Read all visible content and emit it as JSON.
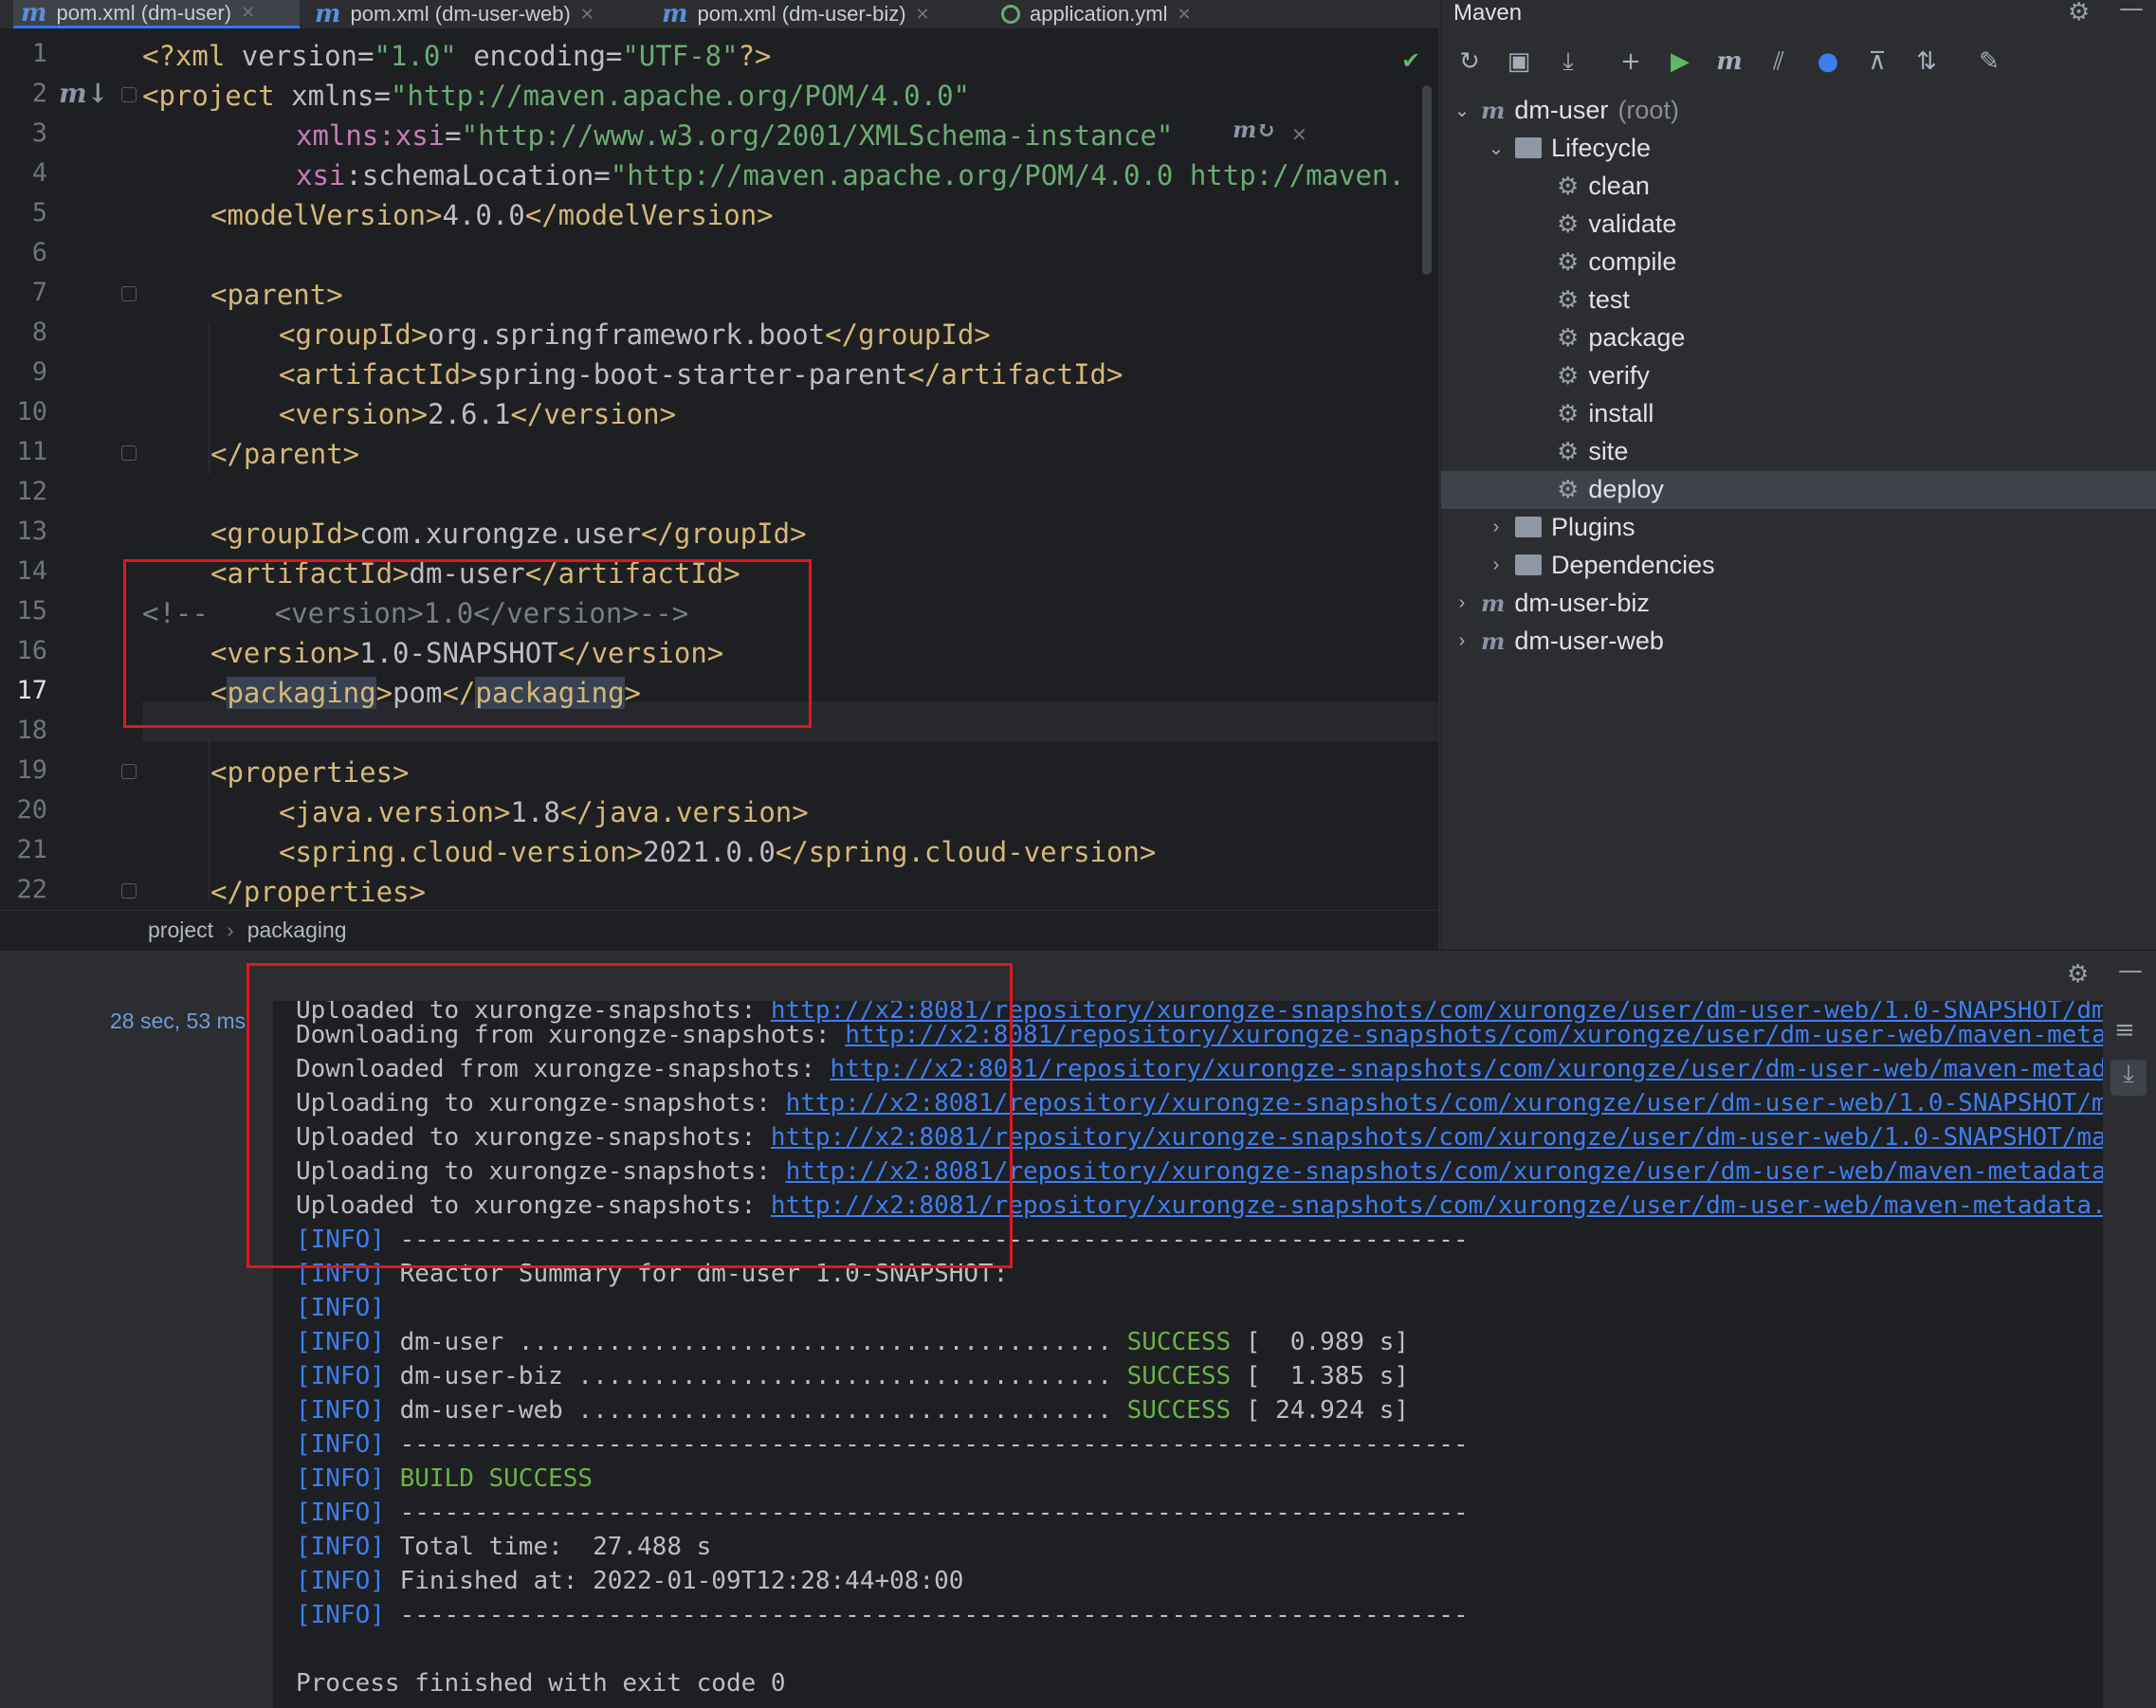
{
  "tabs": [
    {
      "label": "pom.xml (dm-user)",
      "active": true,
      "icon": "maven-icon"
    },
    {
      "label": "pom.xml (dm-user-web)",
      "active": false,
      "icon": "maven-icon"
    },
    {
      "label": "pom.xml (dm-user-biz)",
      "active": false,
      "icon": "maven-icon"
    },
    {
      "label": "application.yml",
      "active": false,
      "icon": "yaml-icon"
    }
  ],
  "editor": {
    "line_numbers": [
      "1",
      "2",
      "3",
      "4",
      "5",
      "6",
      "7",
      "8",
      "9",
      "10",
      "11",
      "12",
      "13",
      "14",
      "15",
      "16",
      "17",
      "18",
      "19",
      "20",
      "21",
      "22"
    ],
    "current_line": "17",
    "lines": {
      "l1": [
        "<?",
        "xml ",
        "version",
        "=",
        "\"1.0\"",
        " encoding",
        "=",
        "\"UTF-8\"",
        "?>"
      ],
      "l2_tag": "<project",
      "l2_attr": " xmlns",
      "l2_eq": "=",
      "l2_val": "\"http://maven.apache.org/POM/4.0.0\"",
      "l3_ns": "xmlns:xsi",
      "l3_eq": "=",
      "l3_val": "\"http://www.w3.org/2001/XMLSchema-instance\"",
      "l4_ns": "xsi",
      "l4_attr": ":schemaLocation",
      "l4_eq": "=",
      "l4_val": "\"http://maven.apache.org/POM/4.0.0 http://maven.",
      "l5": [
        "<modelVersion>",
        "4.0.0",
        "</modelVersion>"
      ],
      "l7": "<parent>",
      "l8": [
        "<groupId>",
        "org.springframework.boot",
        "</groupId>"
      ],
      "l9": [
        "<artifactId>",
        "spring-boot-starter-parent",
        "</artifactId>"
      ],
      "l10": [
        "<version>",
        "2.6.1",
        "</version>"
      ],
      "l11": "</parent>",
      "l13": [
        "<groupId>",
        "com.xurongze.user",
        "</groupId>"
      ],
      "l14": [
        "<artifactId>",
        "dm-user",
        "</artifactId>"
      ],
      "l15": "<!--    <version>1.0</version>-->",
      "l16": [
        "<version>",
        "1.0-SNAPSHOT",
        "</version>"
      ],
      "l17": [
        "<",
        "packaging",
        ">",
        "pom",
        "</",
        "packaging",
        ">"
      ],
      "l19": "<properties>",
      "l20": [
        "<java.version>",
        "1.8",
        "</java.version>"
      ],
      "l21": [
        "<spring.cloud-version>",
        "2021.0.0",
        "</spring.cloud-version>"
      ],
      "l22": "</properties>"
    }
  },
  "breadcrumb": [
    "project",
    "packaging"
  ],
  "maven": {
    "title": "Maven",
    "toolbar": [
      "reload-icon",
      "add-folder-icon",
      "download-icon",
      "plus-icon",
      "run-icon",
      "maven-goal-icon",
      "toggle-offline-icon",
      "skip-tests-icon",
      "show-dependencies-icon",
      "collapse-all-icon",
      "settings-wrench-icon"
    ],
    "root": {
      "label": "dm-user",
      "suffix": "(root)"
    },
    "lifecycle_label": "Lifecycle",
    "lifecycle": [
      "clean",
      "validate",
      "compile",
      "test",
      "package",
      "verify",
      "install",
      "site",
      "deploy"
    ],
    "selected": "deploy",
    "plugins_label": "Plugins",
    "dependencies_label": "Dependencies",
    "modules": [
      "dm-user-biz",
      "dm-user-web"
    ]
  },
  "run": {
    "time": "28 sec, 53 ms",
    "console": [
      {
        "pre": "Uploaded to xurongze-snapshots: ",
        "link": "http://x2:8081/repository/xurongze-snapshots/com/xurongze/user/dm-user-web/1.0-SNAPSHOT/dm"
      },
      {
        "pre": "Downloading from xurongze-snapshots: ",
        "link": "http://x2:8081/repository/xurongze-snapshots/com/xurongze/user/dm-user-web/maven-meta"
      },
      {
        "pre": "Downloaded from xurongze-snapshots: ",
        "link": "http://x2:8081/repository/xurongze-snapshots/com/xurongze/user/dm-user-web/maven-metad"
      },
      {
        "pre": "Uploading to xurongze-snapshots: ",
        "link": "http://x2:8081/repository/xurongze-snapshots/com/xurongze/user/dm-user-web/1.0-SNAPSHOT/m"
      },
      {
        "pre": "Uploaded to xurongze-snapshots: ",
        "link": "http://x2:8081/repository/xurongze-snapshots/com/xurongze/user/dm-user-web/1.0-SNAPSHOT/ma"
      },
      {
        "pre": "Uploading to xurongze-snapshots: ",
        "link": "http://x2:8081/repository/xurongze-snapshots/com/xurongze/user/dm-user-web/maven-metadata"
      },
      {
        "pre": "Uploaded to xurongze-snapshots: ",
        "link": "http://x2:8081/repository/xurongze-snapshots/com/xurongze/user/dm-user-web/maven-metadata."
      }
    ],
    "info_tag": "[INFO]",
    "separator": " ------------------------------------------------------------------------",
    "reactor": " Reactor Summary for dm-user 1.0-SNAPSHOT:",
    "modules": [
      {
        "name": " dm-user ........................................ ",
        "status": "SUCCESS",
        "time": " [  0.989 s]"
      },
      {
        "name": " dm-user-biz .................................... ",
        "status": "SUCCESS",
        "time": " [  1.385 s]"
      },
      {
        "name": " dm-user-web .................................... ",
        "status": "SUCCESS",
        "time": " [ 24.924 s]"
      }
    ],
    "build_success": " BUILD SUCCESS",
    "total_time": " Total time:  27.488 s",
    "finished_at": " Finished at: 2022-01-09T12:28:44+08:00",
    "exit": "Process finished with exit code 0"
  }
}
